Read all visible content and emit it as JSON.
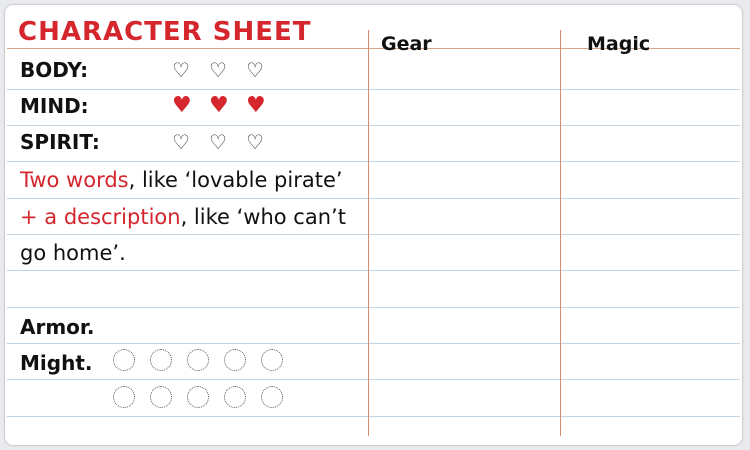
{
  "sheet": {
    "title": "CHARACTER SHEET",
    "columns": {
      "gear": "Gear",
      "magic": "Magic"
    },
    "stats": [
      {
        "label": "BODY:",
        "filled": 0,
        "max": 3
      },
      {
        "label": "MIND:",
        "filled": 3,
        "max": 3
      },
      {
        "label": "SPIRIT:",
        "filled": 0,
        "max": 3
      }
    ],
    "description": {
      "part1": "Two words",
      "part2": ", like ‘lovable pirate’ ",
      "part3": "+ a description",
      "part4": ", like ‘who can’t go home’."
    },
    "armor_label": "Armor.",
    "might_label": "Might.",
    "might_boxes": 10,
    "colors": {
      "accent_red": "#d4262c",
      "ruled_line": "#c4d3e2",
      "column_line": "#d98a70"
    }
  }
}
